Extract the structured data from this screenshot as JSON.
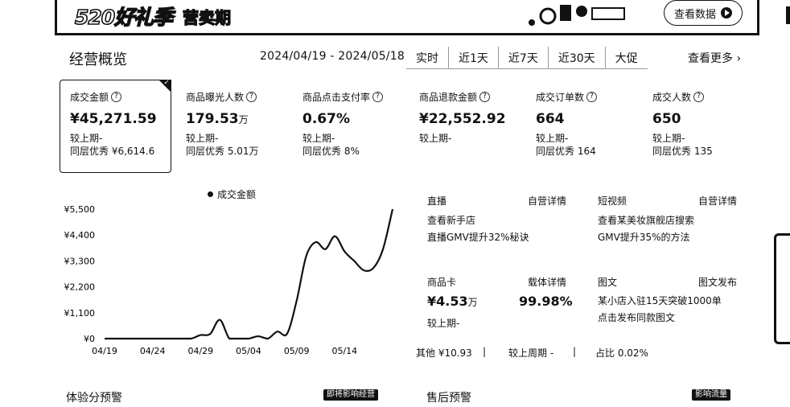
{
  "banner": {
    "logo_text": "520好礼季",
    "logo_text2": "营卖期",
    "button_label": "查看数据"
  },
  "overview": {
    "title": "经营概览",
    "date_range": "2024/04/19 - 2024/05/18",
    "tabs": [
      "实时",
      "近1天",
      "近7天",
      "近30天",
      "大促"
    ],
    "more_label": "查看更多"
  },
  "metrics": [
    {
      "label": "成交金额",
      "value": "¥45,271.59",
      "unit": "",
      "compare": "较上期-",
      "peer": "同层优秀 ¥6,614.6"
    },
    {
      "label": "商品曝光人数",
      "value": "179.53",
      "unit": "万",
      "compare": "较上期-",
      "peer": "同层优秀 5.01万"
    },
    {
      "label": "商品点击支付率",
      "value": "0.67%",
      "unit": "",
      "compare": "较上期-",
      "peer": "同层优秀 8%"
    },
    {
      "label": "商品退款金额",
      "value": "¥22,552.92",
      "unit": "",
      "compare": "较上期-",
      "peer": ""
    },
    {
      "label": "成交订单数",
      "value": "664",
      "unit": "",
      "compare": "较上期-",
      "peer": "同层优秀 164"
    },
    {
      "label": "成交人数",
      "value": "650",
      "unit": "",
      "compare": "较上期-",
      "peer": "同层优秀 135"
    }
  ],
  "chart_data": {
    "type": "line",
    "series": [
      {
        "name": "成交金额",
        "values": [
          0,
          0,
          0,
          0,
          0,
          0,
          0,
          0,
          0,
          0,
          150,
          200,
          800,
          0,
          0,
          0,
          100,
          0,
          300,
          200,
          1600,
          3500,
          4100,
          3800,
          4350,
          3700,
          3300,
          2900,
          3000,
          3800,
          5500
        ]
      }
    ],
    "x": [
      "04/19",
      "04/20",
      "04/21",
      "04/22",
      "04/23",
      "04/24",
      "04/25",
      "04/26",
      "04/27",
      "04/28",
      "04/29",
      "04/30",
      "05/01",
      "05/02",
      "05/03",
      "05/04",
      "05/05",
      "05/06",
      "05/07",
      "05/08",
      "05/09",
      "05/10",
      "05/11",
      "05/12",
      "05/13",
      "05/14",
      "05/15",
      "05/16",
      "05/17",
      "05/18",
      "05/18"
    ],
    "x_ticks": [
      "04/19",
      "04/24",
      "04/29",
      "05/04",
      "05/09",
      "05/14"
    ],
    "y_ticks": [
      "¥0",
      "¥1,100",
      "¥2,200",
      "¥3,300",
      "¥4,400",
      "¥5,500"
    ],
    "ylim": [
      0,
      5500
    ],
    "legend": "top"
  },
  "live": {
    "title": "直播",
    "link": "自营详情",
    "line1": "查看新手店",
    "line2": "直播GMV提升32%秘诀"
  },
  "video": {
    "title": "短视频",
    "link": "自营详情",
    "line1": "查看某美妆旗舰店搜索",
    "line2": "GMV提升35%的方法"
  },
  "card": {
    "title": "商品卡",
    "link": "载体详情",
    "value": "¥4.53",
    "unit": "万",
    "percent": "99.98%",
    "compare": "较上期-"
  },
  "graphic": {
    "title": "图文",
    "link": "图文发布",
    "line1": "某小店入驻15天突破1000单",
    "line2": "点击发布同款图文"
  },
  "other": {
    "label": "其他 ¥10.93",
    "compare": "较上周期 -",
    "ratio": "占比 0.02%"
  },
  "bottom": {
    "left_title": "体验分预警",
    "left_pill": "即将影响经营",
    "right_title": "售后预警",
    "right_pill": "影响流量"
  }
}
